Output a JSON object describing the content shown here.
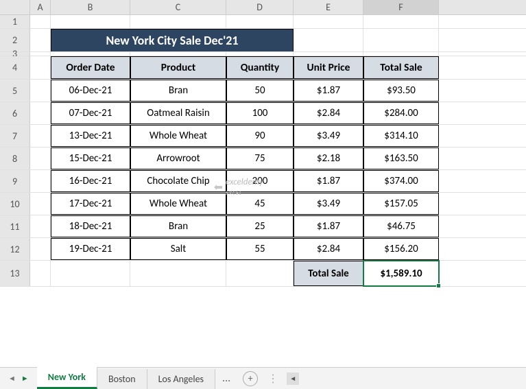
{
  "columns": [
    "A",
    "B",
    "C",
    "D",
    "E",
    "F"
  ],
  "rows": [
    "1",
    "2",
    "3",
    "4",
    "5",
    "6",
    "7",
    "8",
    "9",
    "10",
    "11",
    "12",
    "13"
  ],
  "title": "New York City Sale Dec'21",
  "headers": {
    "b": "Order Date",
    "c": "Product",
    "d": "Quantity",
    "e": "Unit Price",
    "f": "Total Sale"
  },
  "data": [
    {
      "date": "06-Dec-21",
      "product": "Bran",
      "qty": "50",
      "price": "$1.87",
      "total": "$93.50"
    },
    {
      "date": "07-Dec-21",
      "product": "Oatmeal Raisin",
      "qty": "100",
      "price": "$2.84",
      "total": "$284.00"
    },
    {
      "date": "13-Dec-21",
      "product": "Whole Wheat",
      "qty": "90",
      "price": "$3.49",
      "total": "$314.10"
    },
    {
      "date": "15-Dec-21",
      "product": "Arrowroot",
      "qty": "75",
      "price": "$2.18",
      "total": "$163.50"
    },
    {
      "date": "16-Dec-21",
      "product": "Chocolate Chip",
      "qty": "200",
      "price": "$1.87",
      "total": "$374.00"
    },
    {
      "date": "17-Dec-21",
      "product": "Whole Wheat",
      "qty": "45",
      "price": "$3.49",
      "total": "$157.05"
    },
    {
      "date": "18-Dec-21",
      "product": "Bran",
      "qty": "25",
      "price": "$1.87",
      "total": "$46.75"
    },
    {
      "date": "19-Dec-21",
      "product": "Salt",
      "qty": "55",
      "price": "$2.84",
      "total": "$156.20"
    }
  ],
  "total": {
    "label": "Total Sale",
    "value": "$1,589.10"
  },
  "tabs": {
    "active": "New York",
    "others": [
      "Boston",
      "Los Angeles"
    ],
    "more": "..."
  },
  "watermark": {
    "brand": "exceldemy",
    "sub": "EXCEL"
  }
}
